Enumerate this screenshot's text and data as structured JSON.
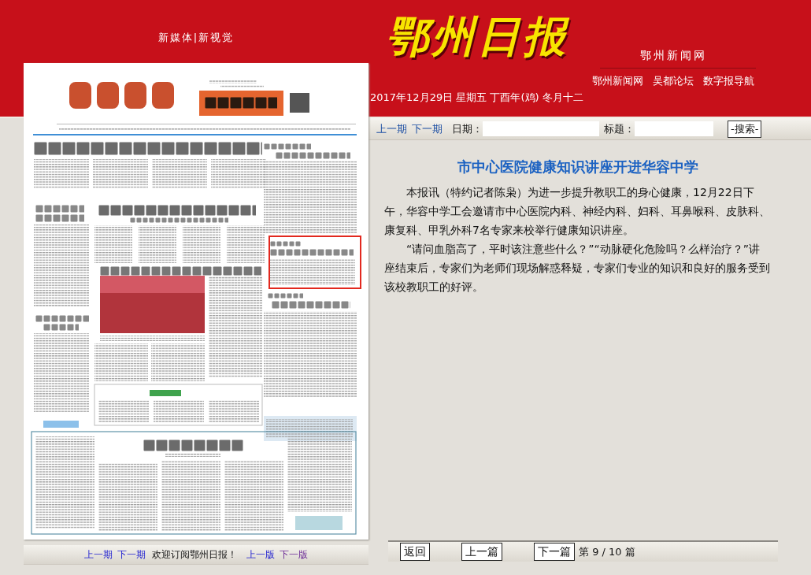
{
  "header": {
    "slogan": "新媒体|新视觉",
    "logo": "鄂州日报",
    "site_name": "鄂州新闻网",
    "links": [
      "鄂州新闻网",
      "吴都论坛",
      "数字报导航"
    ],
    "date": "2017年12月29日 星期五 丁酉年(鸡) 冬月十二"
  },
  "search_bar": {
    "issue_links": [
      "上一期",
      "下一期"
    ],
    "date_label": "日期：",
    "title_label": "标题：",
    "button": "-搜索-"
  },
  "article": {
    "title": "市中心医院健康知识讲座开进华容中学",
    "paragraphs": [
      "本报讯（特约记者陈枭）为进一步提升教职工的身心健康，12月22日下午，华容中学工会邀请市中心医院内科、神经内科、妇科、耳鼻喉科、皮肤科、康复科、甲乳外科7名专家来校举行健康知识讲座。",
      "“请问血脂高了，平时该注意些什么？”“动脉硬化危险吗？么样治疗？”讲座结束后，专家们为老师们现场解惑释疑，专家们专业的知识和良好的服务受到该校教职工的好评。"
    ]
  },
  "page_footer": [
    {
      "kind": "link",
      "label": "上一期",
      "visited": false
    },
    {
      "kind": "link",
      "label": "下一期",
      "visited": false
    },
    {
      "kind": "text",
      "label": "欢迎订阅鄂州日报！"
    },
    {
      "kind": "link",
      "label": "上一版",
      "visited": false
    },
    {
      "kind": "link",
      "label": "下一版",
      "visited": true
    }
  ],
  "article_nav": {
    "buttons": [
      "返回",
      "上一篇",
      "下一篇"
    ],
    "position": "第 9 / 10 篇"
  }
}
